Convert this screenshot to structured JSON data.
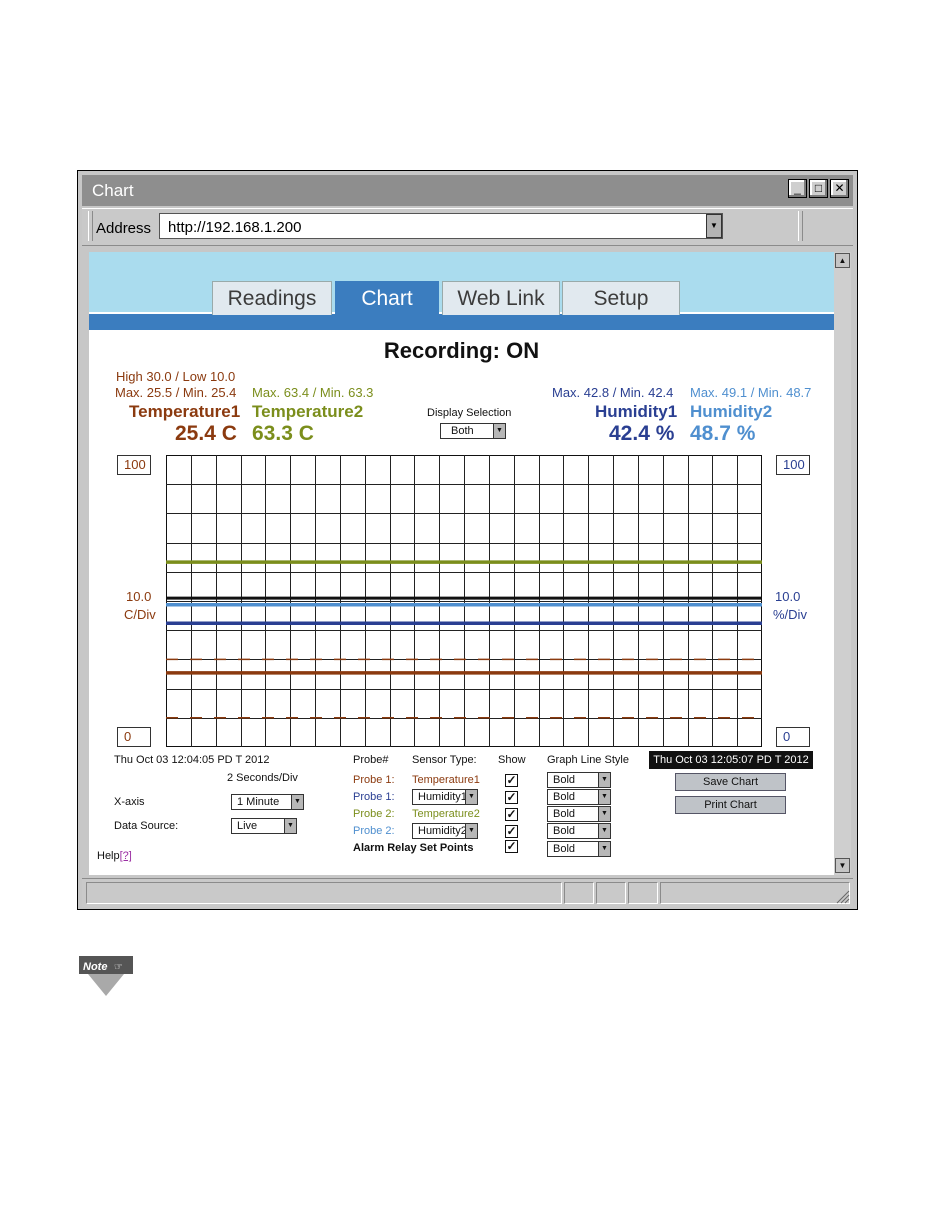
{
  "window": {
    "title": "Chart",
    "controls": {
      "minimize": "_",
      "maximize": "□",
      "close": "✕"
    }
  },
  "address": {
    "label": "Address",
    "value": "http://192.168.1.200"
  },
  "tabs": [
    {
      "label": "Readings",
      "active": false
    },
    {
      "label": "Chart",
      "active": true
    },
    {
      "label": "Web Link",
      "active": false
    },
    {
      "label": "Setup",
      "active": false
    }
  ],
  "recording": "Recording: ON",
  "temp1": {
    "high_low": "High 30.0 / Low 10.0",
    "maxmin": "Max. 25.5 / Min. 25.4",
    "name": "Temperature1",
    "value": "25.4 C"
  },
  "temp2": {
    "maxmin": "Max. 63.4 / Min. 63.3",
    "name": "Temperature2",
    "value": "63.3 C"
  },
  "hum1": {
    "maxmin": "Max. 42.8 / Min. 42.4",
    "name": "Humidity1",
    "value": "42.4 %"
  },
  "hum2": {
    "maxmin": "Max. 49.1 / Min. 48.7",
    "name": "Humidity2",
    "value": "48.7 %"
  },
  "display_selection": {
    "label": "Display Selection",
    "value": "Both"
  },
  "axis": {
    "left_top": "100",
    "left_bottom": "0",
    "left_div_value": "10.0",
    "left_div_unit": "C/Div",
    "right_top": "100",
    "right_bottom": "0",
    "right_div_value": "10.0",
    "right_div_unit": "%/Div"
  },
  "time": {
    "start": "Thu Oct 03 12:04:05 PD T 2012",
    "end": "Thu Oct 03 12:05:07 PD T 2012",
    "per_div": "2 Seconds/Div"
  },
  "controls": {
    "xaxis_label": "X-axis",
    "xaxis_value": "1 Minute",
    "datasource_label": "Data Source:",
    "datasource_value": "Live",
    "help_label": "Help",
    "help_link": "[?]"
  },
  "probe_table": {
    "headers": {
      "probe": "Probe#",
      "sensor": "Sensor Type:",
      "show": "Show",
      "style": "Graph Line Style"
    },
    "rows": [
      {
        "probe": "Probe 1:",
        "sensor": "Temperature1",
        "sensor_is_select": false,
        "style": "Bold"
      },
      {
        "probe": "Probe 1:",
        "sensor": "Humidity1",
        "sensor_is_select": true,
        "style": "Bold"
      },
      {
        "probe": "Probe 2:",
        "sensor": "Temperature2",
        "sensor_is_select": false,
        "style": "Bold"
      },
      {
        "probe": "Probe 2:",
        "sensor": "Humidity2",
        "sensor_is_select": true,
        "style": "Bold"
      },
      {
        "probe": "Alarm Relay Set Points",
        "sensor": "",
        "sensor_is_select": false,
        "style": "Bold"
      }
    ],
    "check": "✓"
  },
  "buttons": {
    "save": "Save Chart",
    "print": "Print Chart"
  },
  "note_label": "Note",
  "colors": {
    "temperature1": "#8b3a0f",
    "temperature2": "#7b8e1c",
    "humidity1": "#2a3f92",
    "humidity2": "#4f8fcf",
    "tab_active": "#3b7dbf",
    "banner": "#aadcee"
  },
  "chart_data": {
    "type": "line",
    "ylim": [
      0,
      100
    ],
    "grid": true,
    "x_divisions": 24,
    "y_divisions": 10,
    "series": [
      {
        "name": "Temperature2",
        "value": 63.3,
        "color": "#7b8e1c",
        "dashed": false
      },
      {
        "name": "Humidity2",
        "value": 48.7,
        "color": "#4f8fcf",
        "dashed": false
      },
      {
        "name": "Humidity1",
        "value": 42.4,
        "color": "#2a3f92",
        "dashed": false
      },
      {
        "name": "Temperature1",
        "value": 25.4,
        "color": "#8b3a0f",
        "dashed": false
      },
      {
        "name": "High 30.0",
        "value": 30.0,
        "color": "#8b3a0f",
        "dashed": true
      },
      {
        "name": "Low 10.0",
        "value": 10.0,
        "color": "#8b3a0f",
        "dashed": true
      }
    ],
    "extra_lines": [
      {
        "value": 51.0,
        "color": "#111111"
      }
    ]
  }
}
